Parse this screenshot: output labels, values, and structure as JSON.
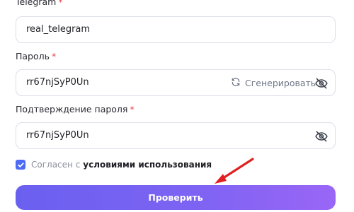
{
  "form": {
    "telegram": {
      "label": "Telegram",
      "required_mark": "*",
      "value": "real_telegram"
    },
    "password": {
      "label": "Пароль",
      "required_mark": "*",
      "value": "rr67njSyP0Un",
      "generate_label": "Сгенерировать",
      "generate_icon": "refresh-icon",
      "visibility_icon": "eye-off-icon"
    },
    "password_confirm": {
      "label": "Подтверждение пароля",
      "required_mark": "*",
      "value": "rr67njSyP0Un",
      "visibility_icon": "eye-off-icon"
    },
    "agreement": {
      "checked": true,
      "text": "Согласен с",
      "link": "условиями использования"
    },
    "submit_label": "Проверить"
  },
  "colors": {
    "accent": "#4d6bf5",
    "button_gradient_start": "#6a60f0",
    "button_gradient_end": "#9a66f6",
    "required": "#e5484d",
    "annotation_arrow": "#e02020"
  }
}
